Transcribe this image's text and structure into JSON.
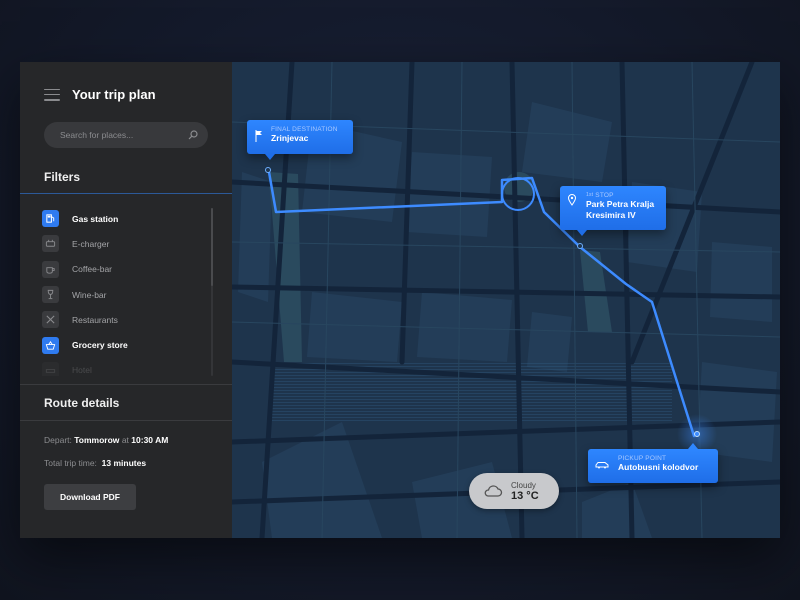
{
  "sidebar": {
    "title": "Your trip plan",
    "search": {
      "placeholder": "Search for places..."
    },
    "filters_title": "Filters",
    "filters": [
      {
        "label": "Gas station",
        "icon": "gas-pump-icon",
        "active": true
      },
      {
        "label": "E-charger",
        "icon": "ev-charger-icon",
        "active": false
      },
      {
        "label": "Coffee-bar",
        "icon": "coffee-cup-icon",
        "active": false
      },
      {
        "label": "Wine-bar",
        "icon": "wine-glass-icon",
        "active": false
      },
      {
        "label": "Restaurants",
        "icon": "fork-knife-icon",
        "active": false
      },
      {
        "label": "Grocery store",
        "icon": "basket-icon",
        "active": true
      },
      {
        "label": "Hotel",
        "icon": "bed-icon",
        "active": false
      }
    ],
    "route_title": "Route details",
    "depart_label": "Depart:",
    "depart_value": "Tommorow",
    "depart_at": "at",
    "depart_time": "10:30 AM",
    "trip_time_label": "Total trip time:",
    "trip_time_value": "13 minutes",
    "download_label": "Download PDF"
  },
  "map": {
    "final": {
      "small": "FINAL DESTINATION",
      "name": "Zrinjevac"
    },
    "stop": {
      "small_sup": "1st",
      "small": " STOP",
      "line1": "Park Petra Kralja",
      "line2": "Kresimira IV"
    },
    "pickup": {
      "small": "PICKUP POINT",
      "name": "Autobusni kolodvor"
    },
    "weather": {
      "condition": "Cloudy",
      "temp": "13 °C"
    }
  },
  "colors": {
    "accent": "#2f7bf0",
    "route": "#3d8bff",
    "map_bg": "#1f3650",
    "sidebar_bg": "#262729"
  }
}
